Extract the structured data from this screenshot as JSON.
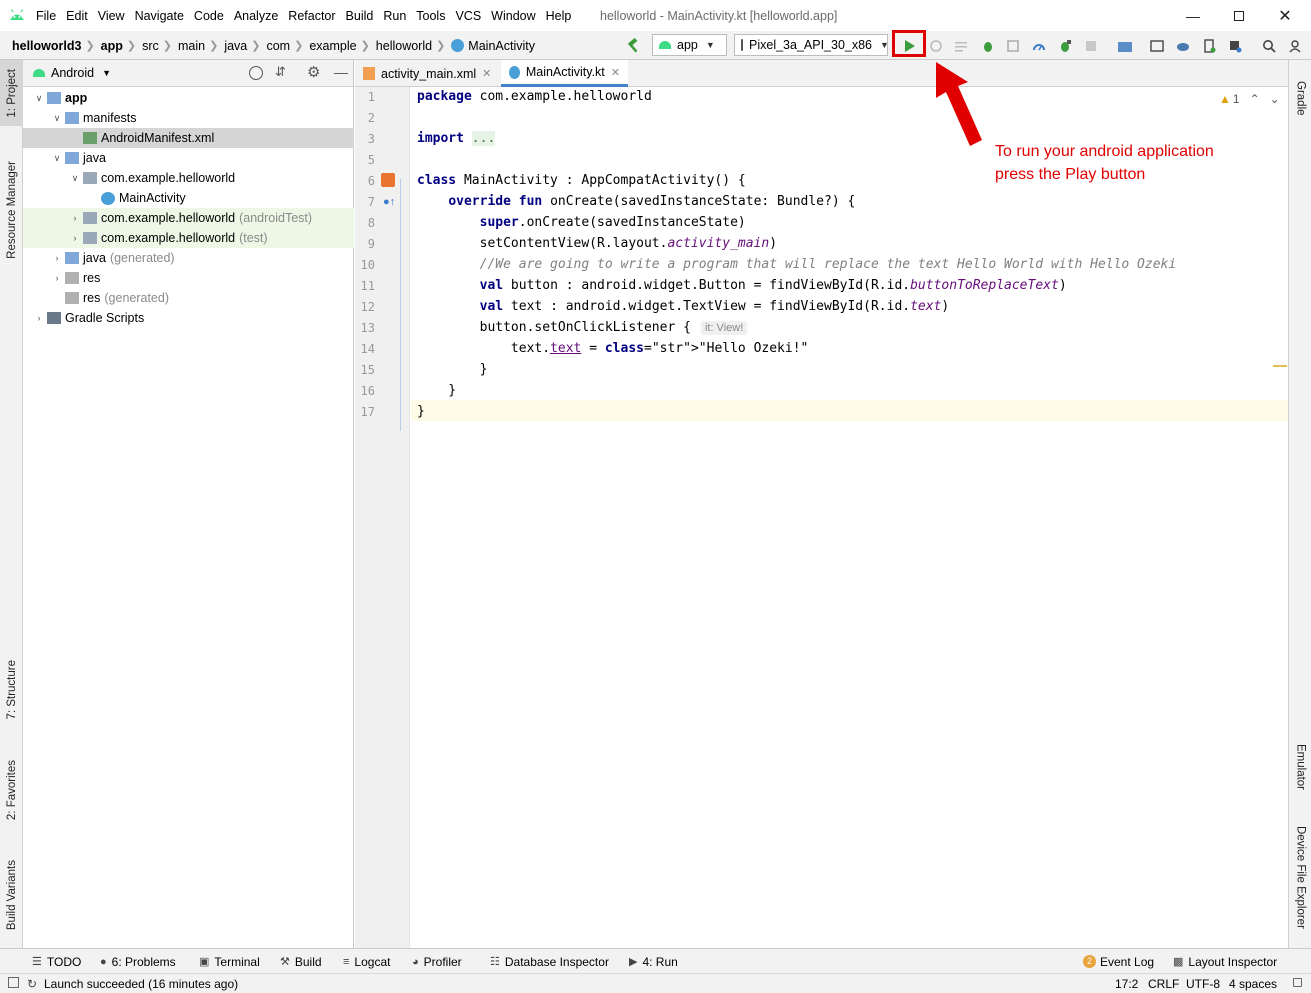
{
  "window": {
    "title": "helloworld - MainActivity.kt [helloworld.app]",
    "minimize_icon": "minimize-icon",
    "maximize_icon": "maximize-icon",
    "close_icon": "close-icon"
  },
  "menu": [
    "File",
    "Edit",
    "View",
    "Navigate",
    "Code",
    "Analyze",
    "Refactor",
    "Build",
    "Run",
    "Tools",
    "VCS",
    "Window",
    "Help"
  ],
  "breadcrumbs": [
    "helloworld3",
    "app",
    "src",
    "main",
    "java",
    "com",
    "example",
    "helloworld",
    "MainActivity"
  ],
  "toolbar": {
    "config": "app",
    "device": "Pixel_3a_API_30_x86",
    "run_tooltip_icon": "run-play-icon"
  },
  "project_panel": {
    "view": "Android",
    "tree": [
      {
        "label": "app",
        "level": 0,
        "bold": true
      },
      {
        "label": "manifests",
        "level": 1
      },
      {
        "label": "AndroidManifest.xml",
        "level": 2,
        "selected": true
      },
      {
        "label": "java",
        "level": 1
      },
      {
        "label": "com.example.helloworld",
        "level": 2
      },
      {
        "label": "MainActivity",
        "level": 3
      },
      {
        "label": "com.example.helloworld",
        "suffix": "(androidTest)",
        "level": 2,
        "green": true
      },
      {
        "label": "com.example.helloworld",
        "suffix": "(test)",
        "level": 2,
        "green": true
      },
      {
        "label": "java",
        "suffix": "(generated)",
        "level": 1
      },
      {
        "label": "res",
        "level": 1
      },
      {
        "label": "res",
        "suffix": "(generated)",
        "level": 1
      },
      {
        "label": "Gradle Scripts",
        "level": 0
      }
    ]
  },
  "editor_tabs": [
    {
      "label": "activity_main.xml",
      "active": false
    },
    {
      "label": "MainActivity.kt",
      "active": true
    }
  ],
  "editor": {
    "warnings": "1",
    "line_numbers": [
      "1",
      "2",
      "3",
      "5",
      "6",
      "7",
      "8",
      "9",
      "10",
      "11",
      "12",
      "13",
      "14",
      "15",
      "16",
      "17"
    ],
    "code_lines": [
      "package com.example.helloworld",
      "",
      "import ...",
      "",
      "class MainActivity : AppCompatActivity() {",
      "    override fun onCreate(savedInstanceState: Bundle?) {",
      "        super.onCreate(savedInstanceState)",
      "        setContentView(R.layout.activity_main)",
      "        //We are going to write a program that will replace the text Hello World with Hello Ozeki",
      "        val button : android.widget.Button = findViewById(R.id.buttonToReplaceText)",
      "        val text : android.widget.TextView = findViewById(R.id.text)",
      "        button.setOnClickListener {",
      "            text.text = \"Hello Ozeki!\"",
      "        }",
      "    }",
      "}"
    ],
    "inlay_hint": "it: View!"
  },
  "annotation": {
    "line1": "To run your android application",
    "line2": "press the Play button"
  },
  "left_tool_windows": [
    "1: Project",
    "Resource Manager",
    "7: Structure",
    "2: Favorites",
    "Build Variants"
  ],
  "right_tool_windows": [
    "Gradle",
    "Emulator",
    "Device File Explorer"
  ],
  "bottom_tool_windows": [
    "TODO",
    "6: Problems",
    "Terminal",
    "Build",
    "Logcat",
    "Profiler",
    "Database Inspector",
    "4: Run"
  ],
  "bottom_right_tools": {
    "event_log": "Event Log",
    "event_count": "2",
    "layout_inspector": "Layout Inspector"
  },
  "status": {
    "message": "Launch succeeded (16 minutes ago)",
    "position": "17:2",
    "line_sep": "CRLF",
    "encoding": "UTF-8",
    "indent": "4 spaces"
  },
  "colors": {
    "accent": "#4083c9",
    "run_green": "#3a9c3a",
    "highlight_red": "#e00000"
  }
}
